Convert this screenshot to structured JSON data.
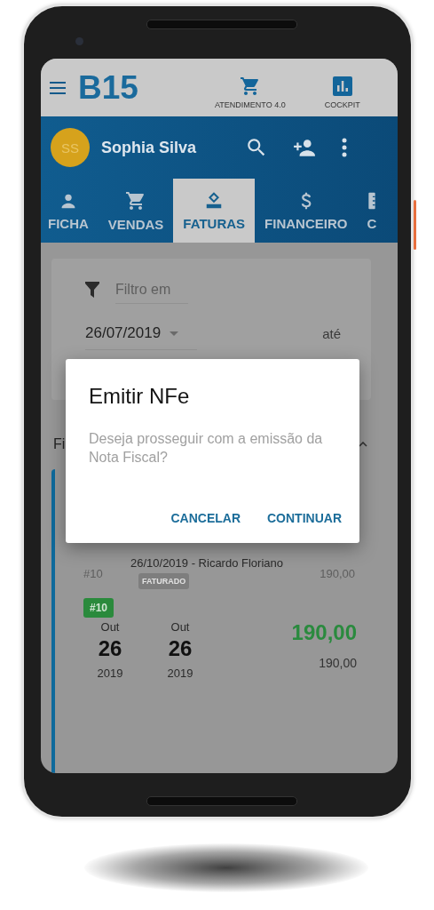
{
  "top_bar": {
    "logo": "B15",
    "shortcuts": [
      {
        "kind": "cart",
        "label": "ATENDIMENTO 4.0"
      },
      {
        "kind": "chart",
        "label": "COCKPIT"
      }
    ]
  },
  "customer": {
    "initials": "SS",
    "name": "Sophia Silva"
  },
  "tabs": [
    {
      "kind": "person",
      "label": "FICHA",
      "selected": false
    },
    {
      "kind": "cart",
      "label": "VENDAS",
      "selected": false
    },
    {
      "kind": "invoice",
      "label": "FATURAS",
      "selected": true
    },
    {
      "kind": "dollar",
      "label": "FINANCEIRO",
      "selected": false
    },
    {
      "kind": "ruler",
      "label": "C",
      "selected": false
    }
  ],
  "filter": {
    "placeholder": "Filtro em",
    "date": "26/07/2019",
    "until_label": "até"
  },
  "section": {
    "title": "Fi"
  },
  "invoice": {
    "number": "#10",
    "title": "26/10/2019 - Ricardo Floriano",
    "status": "FATURADO",
    "amount": "190,00",
    "tag": "#10",
    "dates": [
      {
        "month": "Out",
        "day": "26",
        "year": "2019"
      },
      {
        "month": "Out",
        "day": "26",
        "year": "2019"
      }
    ],
    "total": "190,00",
    "subtotal": "190,00"
  },
  "dialog": {
    "title": "Emitir NFe",
    "message": "Deseja prosseguir com a emissão da Nota Fiscal?",
    "buttons": [
      "CANCELAR",
      "CONTINUAR"
    ]
  }
}
